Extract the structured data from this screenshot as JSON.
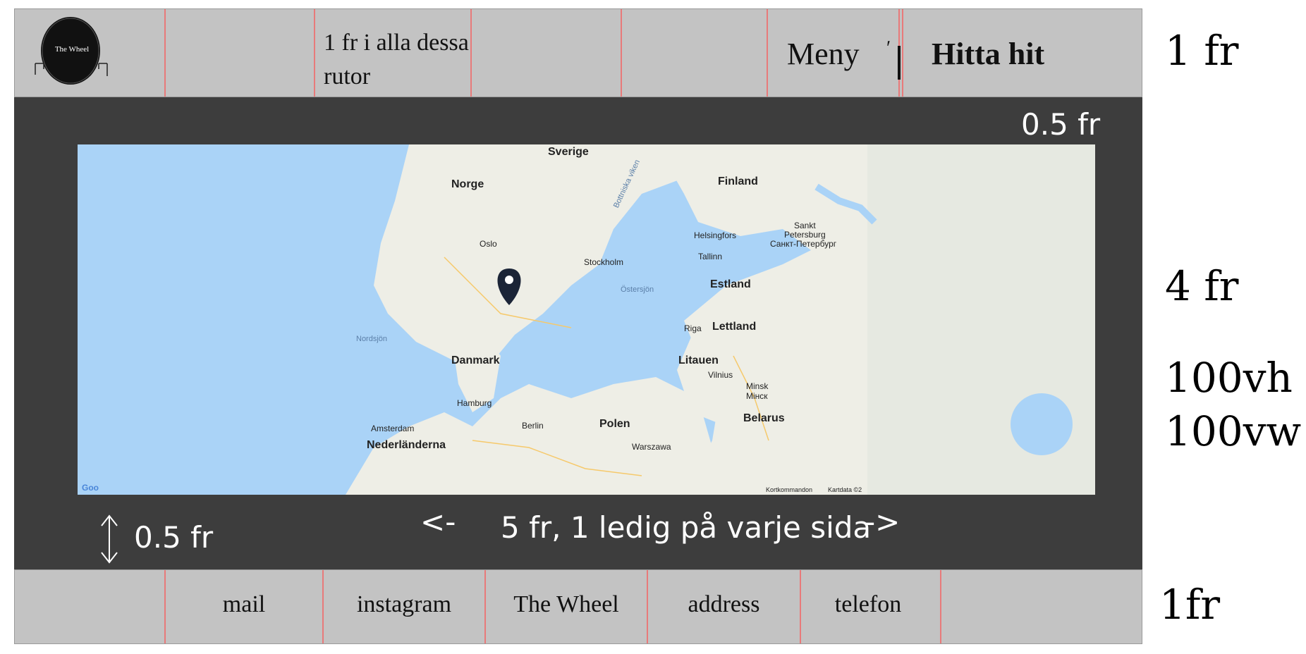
{
  "header": {
    "logo_text": "The Wheel",
    "note_text": "1 fr i alla dessa rutor",
    "note_line1": "1 fr i alla dessa",
    "note_line2": "rutor",
    "menu_label": "Meny",
    "cta_label": "Hitta hit"
  },
  "annotations": {
    "header_height": "1 fr",
    "top_gap": "0.5 fr",
    "map_height": "4 fr",
    "viewport_h": "100vh",
    "viewport_w": "100vw",
    "bottom_gap": "0.5 fr",
    "width_note": "5 fr, 1 ledig på varje sida",
    "arrow_left": "<-",
    "arrow_right": "->",
    "footer_height": "1fr"
  },
  "map": {
    "labels": {
      "sverige": "Sverige",
      "norge": "Norge",
      "finland": "Finland",
      "botniska": "Bottniska viken",
      "helsingfors": "Helsingfors",
      "sankt": "Sankt",
      "petersburg": "Petersburg",
      "petersburg_ru": "Санкт-Петербург",
      "oslo": "Oslo",
      "stockholm": "Stockholm",
      "tallinn": "Tallinn",
      "estland": "Estland",
      "ostersjon": "Östersjön",
      "riga": "Riga",
      "lettland": "Lettland",
      "nordsjon": "Nordsjön",
      "danmark": "Danmark",
      "litauen": "Litauen",
      "vilnius": "Vilnius",
      "minsk": "Minsk",
      "minsk_ru": "Мінск",
      "hamburg": "Hamburg",
      "belarus": "Belarus",
      "berlin": "Berlin",
      "polen": "Polen",
      "amsterdam": "Amsterdam",
      "nederlanderna": "Nederländerna",
      "warszawa": "Warszawa",
      "google": "Goo",
      "shortcuts": "Kortkommandon",
      "mapdata": "Kartdata ©2"
    }
  },
  "footer": {
    "items": [
      "mail",
      "instagram",
      "The Wheel",
      "address",
      "telefon"
    ]
  },
  "colors": {
    "grid_gray": "#c3c3c3",
    "grid_line": "#e87a7a",
    "main_dark": "#3d3d3d",
    "water": "#aad3f7",
    "land": "#eeeee6",
    "pin": "#1b2437"
  }
}
